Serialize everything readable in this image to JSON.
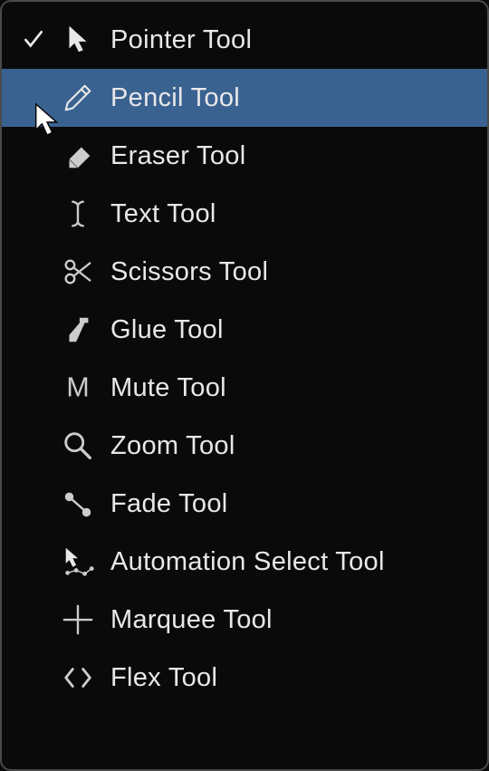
{
  "menu": {
    "items": [
      {
        "label": "Pointer Tool",
        "icon": "pointer",
        "checked": true,
        "selected": false
      },
      {
        "label": "Pencil Tool",
        "icon": "pencil",
        "checked": false,
        "selected": true
      },
      {
        "label": "Eraser Tool",
        "icon": "eraser",
        "checked": false,
        "selected": false
      },
      {
        "label": "Text Tool",
        "icon": "text",
        "checked": false,
        "selected": false
      },
      {
        "label": "Scissors Tool",
        "icon": "scissors",
        "checked": false,
        "selected": false
      },
      {
        "label": "Glue Tool",
        "icon": "glue",
        "checked": false,
        "selected": false
      },
      {
        "label": "Mute Tool",
        "icon": "mute",
        "checked": false,
        "selected": false
      },
      {
        "label": "Zoom Tool",
        "icon": "zoom",
        "checked": false,
        "selected": false
      },
      {
        "label": "Fade Tool",
        "icon": "fade",
        "checked": false,
        "selected": false
      },
      {
        "label": "Automation Select Tool",
        "icon": "automation",
        "checked": false,
        "selected": false
      },
      {
        "label": "Marquee Tool",
        "icon": "marquee",
        "checked": false,
        "selected": false
      },
      {
        "label": "Flex Tool",
        "icon": "flex",
        "checked": false,
        "selected": false
      }
    ]
  },
  "colors": {
    "highlight": "#3a6291",
    "background": "#0a0a0a",
    "text": "#e8e8e8",
    "iconLight": "#cccccc"
  }
}
